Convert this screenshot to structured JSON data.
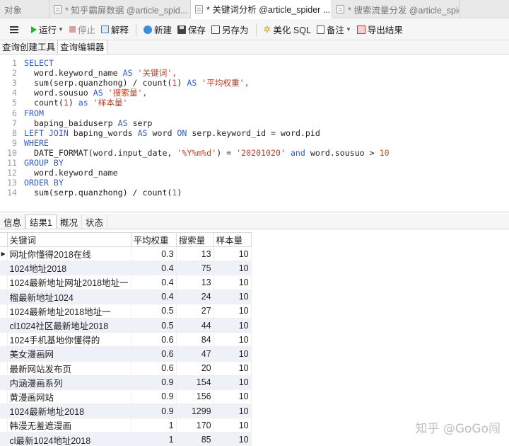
{
  "tabs": [
    {
      "label": "对象",
      "active": false
    },
    {
      "label": "* 知乎霸屏数据 @article_spid...",
      "active": false
    },
    {
      "label": "* 关键词分析 @article_spider ...",
      "active": true
    },
    {
      "label": "* 搜索流量分发 @article_spid...",
      "active": false
    }
  ],
  "toolbar": {
    "run": "运行",
    "stop": "停止",
    "explain": "解释",
    "new": "新建",
    "save": "保存",
    "save_as": "另存为",
    "beautify": "美化 SQL",
    "note": "备注",
    "export": "导出结果"
  },
  "subtabs": [
    "查询创建工具",
    "查询编辑器"
  ],
  "editor": {
    "lines": [
      [
        {
          "t": "SELECT",
          "c": "kw"
        }
      ],
      [
        {
          "t": "  word.keyword_name ",
          "c": "plain"
        },
        {
          "t": "AS",
          "c": "kw"
        },
        {
          "t": " '关键词',",
          "c": "str"
        }
      ],
      [
        {
          "t": "  sum(serp.quanzhong) / count(",
          "c": "plain"
        },
        {
          "t": "1",
          "c": "num"
        },
        {
          "t": ") ",
          "c": "plain"
        },
        {
          "t": "AS",
          "c": "kw"
        },
        {
          "t": " '平均权重',",
          "c": "str"
        }
      ],
      [
        {
          "t": "  word.sousuo ",
          "c": "plain"
        },
        {
          "t": "AS",
          "c": "kw"
        },
        {
          "t": " '搜索量',",
          "c": "str"
        }
      ],
      [
        {
          "t": "  count(",
          "c": "plain"
        },
        {
          "t": "1",
          "c": "num"
        },
        {
          "t": ") ",
          "c": "plain"
        },
        {
          "t": "as",
          "c": "kw"
        },
        {
          "t": " '样本量'",
          "c": "str"
        }
      ],
      [
        {
          "t": "FROM",
          "c": "kw"
        }
      ],
      [
        {
          "t": "  baping_baiduserp ",
          "c": "plain"
        },
        {
          "t": "AS",
          "c": "kw"
        },
        {
          "t": " serp",
          "c": "plain"
        }
      ],
      [
        {
          "t": "LEFT JOIN",
          "c": "kw"
        },
        {
          "t": " baping_words ",
          "c": "plain"
        },
        {
          "t": "AS",
          "c": "kw"
        },
        {
          "t": " word ",
          "c": "plain"
        },
        {
          "t": "ON",
          "c": "kw"
        },
        {
          "t": " serp.keyword_id = word.pid",
          "c": "plain"
        }
      ],
      [
        {
          "t": "WHERE",
          "c": "kw"
        }
      ],
      [
        {
          "t": "  DATE_FORMAT(word.input_date, ",
          "c": "plain"
        },
        {
          "t": "'%Y%m%d'",
          "c": "str"
        },
        {
          "t": ") = ",
          "c": "plain"
        },
        {
          "t": "'20201020'",
          "c": "str"
        },
        {
          "t": " ",
          "c": "plain"
        },
        {
          "t": "and",
          "c": "kw"
        },
        {
          "t": " word.sousuo > ",
          "c": "plain"
        },
        {
          "t": "10",
          "c": "num"
        }
      ],
      [
        {
          "t": "GROUP BY",
          "c": "kw"
        }
      ],
      [
        {
          "t": "  word.keyword_name",
          "c": "plain"
        }
      ],
      [
        {
          "t": "ORDER BY",
          "c": "kw"
        }
      ],
      [
        {
          "t": "  sum(serp.quanzhong) / count(",
          "c": "plain"
        },
        {
          "t": "1",
          "c": "num"
        },
        {
          "t": ")",
          "c": "plain"
        }
      ]
    ]
  },
  "result_tabs": [
    "信息",
    "结果1",
    "概况",
    "状态"
  ],
  "result": {
    "columns": [
      "关键词",
      "平均权重",
      "搜索量",
      "样本量"
    ],
    "rows": [
      [
        "网址你懂得2018在线",
        "0.3",
        "13",
        "10"
      ],
      [
        "1024地址2018",
        "0.4",
        "75",
        "10"
      ],
      [
        "1024最新地址网址2018地址一",
        "0.4",
        "13",
        "10"
      ],
      [
        "榴最新地址1024",
        "0.4",
        "24",
        "10"
      ],
      [
        "1024最新地址2018地址一",
        "0.5",
        "27",
        "10"
      ],
      [
        "cl1024社区最新地址2018",
        "0.5",
        "44",
        "10"
      ],
      [
        "1024手机基地你懂得的",
        "0.6",
        "84",
        "10"
      ],
      [
        "美女漫画网",
        "0.6",
        "47",
        "10"
      ],
      [
        "最新网站发布页",
        "0.6",
        "20",
        "10"
      ],
      [
        "内涵漫画系列",
        "0.9",
        "154",
        "10"
      ],
      [
        "黄漫画网站",
        "0.9",
        "156",
        "10"
      ],
      [
        "1024最新地址2018",
        "0.9",
        "1299",
        "10"
      ],
      [
        "韩漫无羞遮漫画",
        "1",
        "170",
        "10"
      ],
      [
        "cl最新1024地址2018",
        "1",
        "85",
        "10"
      ]
    ]
  },
  "watermark": "知乎 @GoGo闯"
}
